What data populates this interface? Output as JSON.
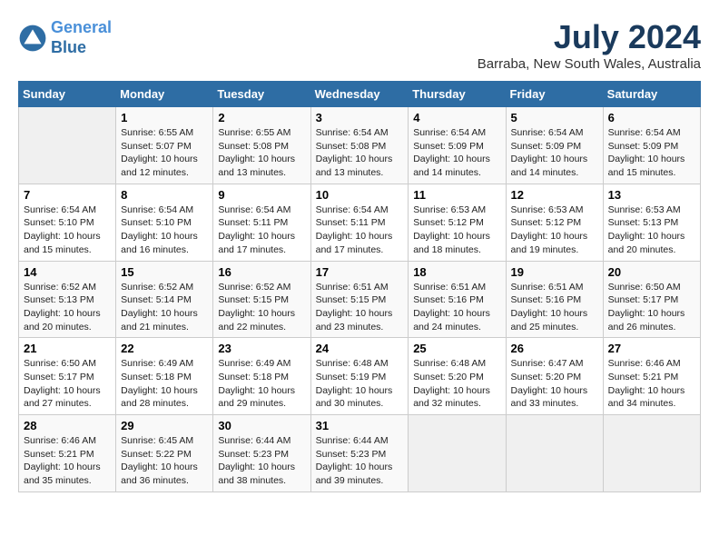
{
  "header": {
    "logo_line1": "General",
    "logo_line2": "Blue",
    "month_title": "July 2024",
    "location": "Barraba, New South Wales, Australia"
  },
  "weekdays": [
    "Sunday",
    "Monday",
    "Tuesday",
    "Wednesday",
    "Thursday",
    "Friday",
    "Saturday"
  ],
  "weeks": [
    [
      {
        "day": "",
        "info": ""
      },
      {
        "day": "1",
        "info": "Sunrise: 6:55 AM\nSunset: 5:07 PM\nDaylight: 10 hours\nand 12 minutes."
      },
      {
        "day": "2",
        "info": "Sunrise: 6:55 AM\nSunset: 5:08 PM\nDaylight: 10 hours\nand 13 minutes."
      },
      {
        "day": "3",
        "info": "Sunrise: 6:54 AM\nSunset: 5:08 PM\nDaylight: 10 hours\nand 13 minutes."
      },
      {
        "day": "4",
        "info": "Sunrise: 6:54 AM\nSunset: 5:09 PM\nDaylight: 10 hours\nand 14 minutes."
      },
      {
        "day": "5",
        "info": "Sunrise: 6:54 AM\nSunset: 5:09 PM\nDaylight: 10 hours\nand 14 minutes."
      },
      {
        "day": "6",
        "info": "Sunrise: 6:54 AM\nSunset: 5:09 PM\nDaylight: 10 hours\nand 15 minutes."
      }
    ],
    [
      {
        "day": "7",
        "info": "Sunrise: 6:54 AM\nSunset: 5:10 PM\nDaylight: 10 hours\nand 15 minutes."
      },
      {
        "day": "8",
        "info": "Sunrise: 6:54 AM\nSunset: 5:10 PM\nDaylight: 10 hours\nand 16 minutes."
      },
      {
        "day": "9",
        "info": "Sunrise: 6:54 AM\nSunset: 5:11 PM\nDaylight: 10 hours\nand 17 minutes."
      },
      {
        "day": "10",
        "info": "Sunrise: 6:54 AM\nSunset: 5:11 PM\nDaylight: 10 hours\nand 17 minutes."
      },
      {
        "day": "11",
        "info": "Sunrise: 6:53 AM\nSunset: 5:12 PM\nDaylight: 10 hours\nand 18 minutes."
      },
      {
        "day": "12",
        "info": "Sunrise: 6:53 AM\nSunset: 5:12 PM\nDaylight: 10 hours\nand 19 minutes."
      },
      {
        "day": "13",
        "info": "Sunrise: 6:53 AM\nSunset: 5:13 PM\nDaylight: 10 hours\nand 20 minutes."
      }
    ],
    [
      {
        "day": "14",
        "info": "Sunrise: 6:52 AM\nSunset: 5:13 PM\nDaylight: 10 hours\nand 20 minutes."
      },
      {
        "day": "15",
        "info": "Sunrise: 6:52 AM\nSunset: 5:14 PM\nDaylight: 10 hours\nand 21 minutes."
      },
      {
        "day": "16",
        "info": "Sunrise: 6:52 AM\nSunset: 5:15 PM\nDaylight: 10 hours\nand 22 minutes."
      },
      {
        "day": "17",
        "info": "Sunrise: 6:51 AM\nSunset: 5:15 PM\nDaylight: 10 hours\nand 23 minutes."
      },
      {
        "day": "18",
        "info": "Sunrise: 6:51 AM\nSunset: 5:16 PM\nDaylight: 10 hours\nand 24 minutes."
      },
      {
        "day": "19",
        "info": "Sunrise: 6:51 AM\nSunset: 5:16 PM\nDaylight: 10 hours\nand 25 minutes."
      },
      {
        "day": "20",
        "info": "Sunrise: 6:50 AM\nSunset: 5:17 PM\nDaylight: 10 hours\nand 26 minutes."
      }
    ],
    [
      {
        "day": "21",
        "info": "Sunrise: 6:50 AM\nSunset: 5:17 PM\nDaylight: 10 hours\nand 27 minutes."
      },
      {
        "day": "22",
        "info": "Sunrise: 6:49 AM\nSunset: 5:18 PM\nDaylight: 10 hours\nand 28 minutes."
      },
      {
        "day": "23",
        "info": "Sunrise: 6:49 AM\nSunset: 5:18 PM\nDaylight: 10 hours\nand 29 minutes."
      },
      {
        "day": "24",
        "info": "Sunrise: 6:48 AM\nSunset: 5:19 PM\nDaylight: 10 hours\nand 30 minutes."
      },
      {
        "day": "25",
        "info": "Sunrise: 6:48 AM\nSunset: 5:20 PM\nDaylight: 10 hours\nand 32 minutes."
      },
      {
        "day": "26",
        "info": "Sunrise: 6:47 AM\nSunset: 5:20 PM\nDaylight: 10 hours\nand 33 minutes."
      },
      {
        "day": "27",
        "info": "Sunrise: 6:46 AM\nSunset: 5:21 PM\nDaylight: 10 hours\nand 34 minutes."
      }
    ],
    [
      {
        "day": "28",
        "info": "Sunrise: 6:46 AM\nSunset: 5:21 PM\nDaylight: 10 hours\nand 35 minutes."
      },
      {
        "day": "29",
        "info": "Sunrise: 6:45 AM\nSunset: 5:22 PM\nDaylight: 10 hours\nand 36 minutes."
      },
      {
        "day": "30",
        "info": "Sunrise: 6:44 AM\nSunset: 5:23 PM\nDaylight: 10 hours\nand 38 minutes."
      },
      {
        "day": "31",
        "info": "Sunrise: 6:44 AM\nSunset: 5:23 PM\nDaylight: 10 hours\nand 39 minutes."
      },
      {
        "day": "",
        "info": ""
      },
      {
        "day": "",
        "info": ""
      },
      {
        "day": "",
        "info": ""
      }
    ]
  ]
}
